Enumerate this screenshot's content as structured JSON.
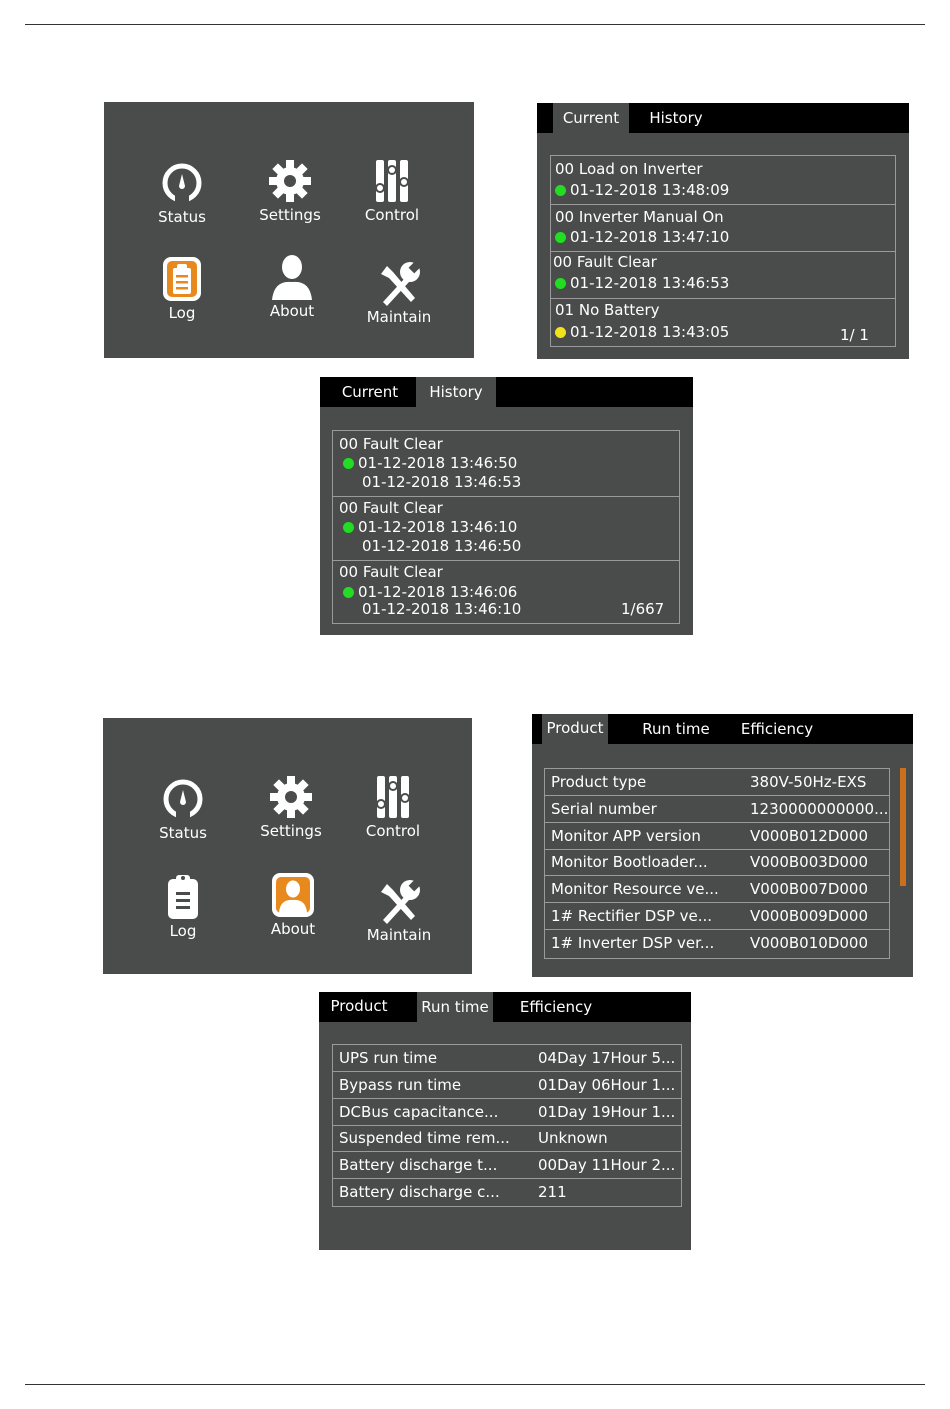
{
  "menu": {
    "status": "Status",
    "settings": "Settings",
    "control": "Control",
    "log": "Log",
    "about": "About",
    "maintain": "Maintain"
  },
  "log_current": {
    "tabs": [
      "Current",
      "History"
    ],
    "entries": [
      {
        "title": "00 Load on Inverter",
        "time": "01-12-2018 13:48:09",
        "status_color": "#22dd22"
      },
      {
        "title": "00 Inverter Manual On",
        "time": "01-12-2018 13:47:10",
        "status_color": "#22dd22"
      },
      {
        "title": "00 Fault Clear",
        "time": "01-12-2018 13:46:53",
        "status_color": "#22dd22"
      },
      {
        "title": "01 No Battery",
        "time": "01-12-2018 13:43:05",
        "status_color": "#f2e21a"
      }
    ],
    "page": "1/ 1"
  },
  "log_history": {
    "tabs": [
      "Current",
      "History"
    ],
    "entries": [
      {
        "title": "00 Fault Clear",
        "start": "01-12-2018 13:46:50",
        "end": "01-12-2018 13:46:53",
        "status_color": "#22dd22"
      },
      {
        "title": "00 Fault Clear",
        "start": "01-12-2018 13:46:10",
        "end": "01-12-2018 13:46:50",
        "status_color": "#22dd22"
      },
      {
        "title": "00 Fault Clear",
        "start": "01-12-2018 13:46:06",
        "end": "01-12-2018 13:46:10",
        "status_color": "#22dd22"
      }
    ],
    "page": "1/667"
  },
  "about_product": {
    "tabs": [
      "Product",
      "Run time",
      "Efficiency"
    ],
    "rows": [
      {
        "key": "Product type",
        "value": "380V-50Hz-EXS"
      },
      {
        "key": "Serial number",
        "value": "1230000000000..."
      },
      {
        "key": "Monitor APP version",
        "value": "V000B012D000"
      },
      {
        "key": "Monitor Bootloader...",
        "value": "V000B003D000"
      },
      {
        "key": "Monitor Resource ve...",
        "value": "V000B007D000"
      },
      {
        "key": "1# Rectifier DSP ve...",
        "value": "V000B009D000"
      },
      {
        "key": "1# Inverter DSP ver...",
        "value": "V000B010D000"
      }
    ]
  },
  "about_runtime": {
    "tabs": [
      "Product",
      "Run time",
      "Efficiency"
    ],
    "rows": [
      {
        "key": "UPS run time",
        "value": "04Day 17Hour 5..."
      },
      {
        "key": "Bypass run time",
        "value": "01Day 06Hour 1..."
      },
      {
        "key": "DCBus capacitance...",
        "value": "01Day 19Hour 1..."
      },
      {
        "key": "Suspended time rem...",
        "value": "Unknown"
      },
      {
        "key": "Battery discharge t...",
        "value": "00Day 11Hour 2..."
      },
      {
        "key": "Battery discharge c...",
        "value": "211"
      }
    ]
  },
  "colors": {
    "panel": "#4a4b4b",
    "accent_orange": "#e8891e",
    "scrollbar": "#c8701d"
  }
}
